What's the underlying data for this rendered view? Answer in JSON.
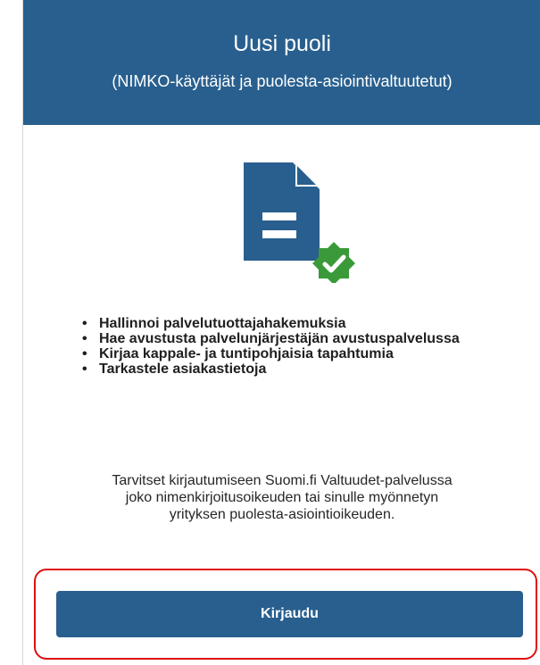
{
  "header": {
    "title": "Uusi puoli",
    "subtitle": "(NIMKO-käyttäjät ja puolesta-asiointivaltuutetut)"
  },
  "illustration": {
    "icon": "document-verified-icon",
    "document_color": "#285f8e",
    "badge_color": "#3a9a3a"
  },
  "features": [
    "Hallinnoi palvelutuottajahakemuksia",
    "Hae avustusta palvelunjärjestäjän avustuspalvelussa",
    "Kirjaa kappale- ja tuntipohjaisia tapahtumia",
    "Tarkastele asiakastietoja"
  ],
  "info": {
    "lines": [
      "Tarvitset kirjautumiseen Suomi.fi Valtuudet-palvelussa",
      "joko nimenkirjoitusoikeuden tai sinulle myönnetyn",
      "yrityksen puolesta-asiointioikeuden."
    ]
  },
  "login": {
    "label": "Kirjaudu"
  },
  "colors": {
    "primary": "#285f8e",
    "highlight": "#e01010"
  }
}
